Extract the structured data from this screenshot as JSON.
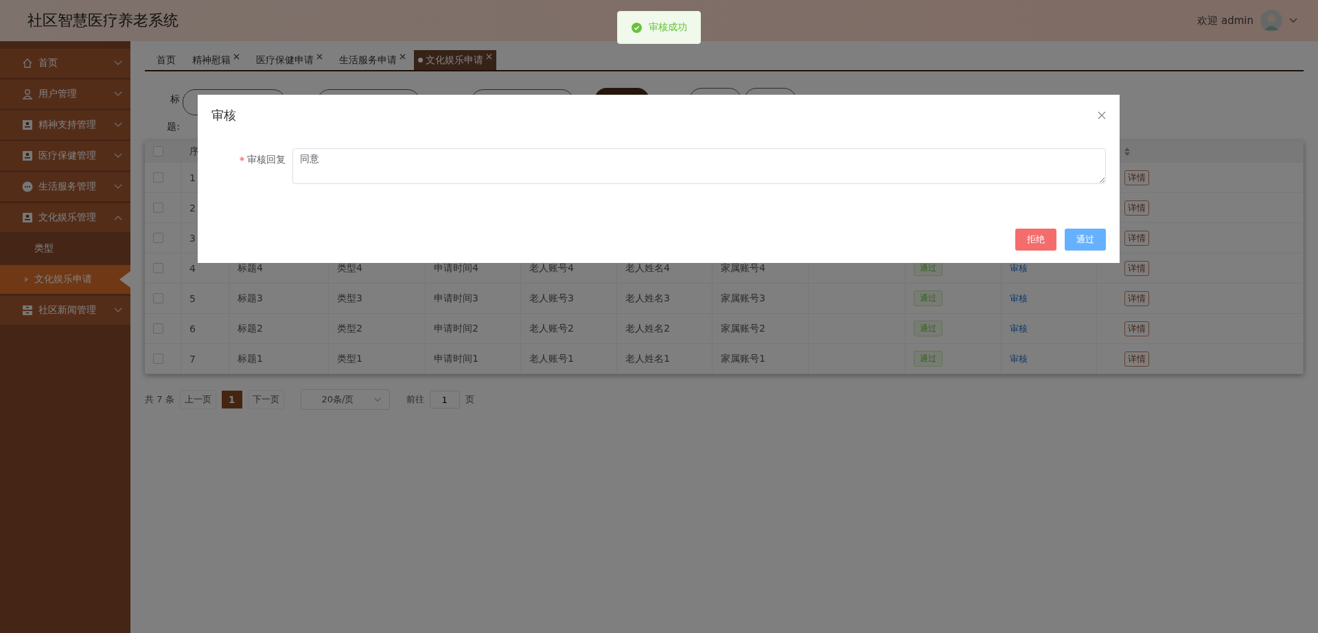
{
  "header": {
    "title": "社区智慧医疗养老系统",
    "welcome": "欢迎 admin"
  },
  "toast": {
    "kind": "success",
    "text": "审核成功"
  },
  "sidebar": {
    "items": [
      {
        "label": "首页",
        "expanded": false
      },
      {
        "label": "用户管理",
        "expanded": false
      },
      {
        "label": "精神支持管理",
        "expanded": false
      },
      {
        "label": "医疗保健管理",
        "expanded": false
      },
      {
        "label": "生活服务管理",
        "expanded": false
      },
      {
        "label": "文化娱乐管理",
        "expanded": true,
        "children": [
          {
            "label": "类型",
            "selected": false
          },
          {
            "label": "文化娱乐申请",
            "selected": true
          }
        ]
      },
      {
        "label": "社区新闻管理",
        "expanded": false
      }
    ]
  },
  "tabs": [
    {
      "label": "首页",
      "selected": false,
      "closable": false
    },
    {
      "label": "精神慰籍",
      "selected": false,
      "closable": true
    },
    {
      "label": "医疗保健申请",
      "selected": false,
      "closable": true
    },
    {
      "label": "生活服务申请",
      "selected": false,
      "closable": true
    },
    {
      "label": "文化娱乐申请",
      "selected": true,
      "closable": true
    }
  ],
  "filter": {
    "label": "标题:"
  },
  "table": {
    "header_checked": false,
    "columns": [
      "序"
    ],
    "rows": [
      {
        "checked": false,
        "index": "1",
        "detail": "详情"
      },
      {
        "checked": false,
        "index": "2",
        "detail": "详情"
      },
      {
        "checked": false,
        "index": "3",
        "detail": "详情"
      },
      {
        "checked": false,
        "index": "4",
        "title": "标题4",
        "type": "类型4",
        "time": "申请时间4",
        "account": "老人账号4",
        "name": "老人姓名4",
        "family": "家属账号4",
        "status": "通过",
        "action": "审核",
        "detail": "详情"
      },
      {
        "checked": false,
        "index": "5",
        "title": "标题3",
        "type": "类型3",
        "time": "申请时间3",
        "account": "老人账号3",
        "name": "老人姓名3",
        "family": "家属账号3",
        "status": "通过",
        "action": "审核",
        "detail": "详情"
      },
      {
        "checked": false,
        "index": "6",
        "title": "标题2",
        "type": "类型2",
        "time": "申请时间2",
        "account": "老人账号2",
        "name": "老人姓名2",
        "family": "家属账号2",
        "status": "通过",
        "action": "审核",
        "detail": "详情"
      },
      {
        "checked": false,
        "index": "7",
        "title": "标题1",
        "type": "类型1",
        "time": "申请时间1",
        "account": "老人账号1",
        "name": "老人姓名1",
        "family": "家属账号1",
        "status": "通过",
        "action": "审核",
        "detail": "详情"
      }
    ]
  },
  "pagination": {
    "total": "共 7 条",
    "prev": "上一页",
    "pages": [
      {
        "label": "1",
        "selected": true
      }
    ],
    "next": "下一页",
    "page_size": "20条/页",
    "goto_label": "前往",
    "goto_value": "1",
    "page_unit": "页"
  },
  "dialog": {
    "title": "审核",
    "field": {
      "label": "审核回复",
      "required": true,
      "value": "同意"
    },
    "buttons": [
      {
        "label": "拒绝",
        "kind": "danger"
      },
      {
        "label": "通过",
        "kind": "primary"
      }
    ]
  }
}
